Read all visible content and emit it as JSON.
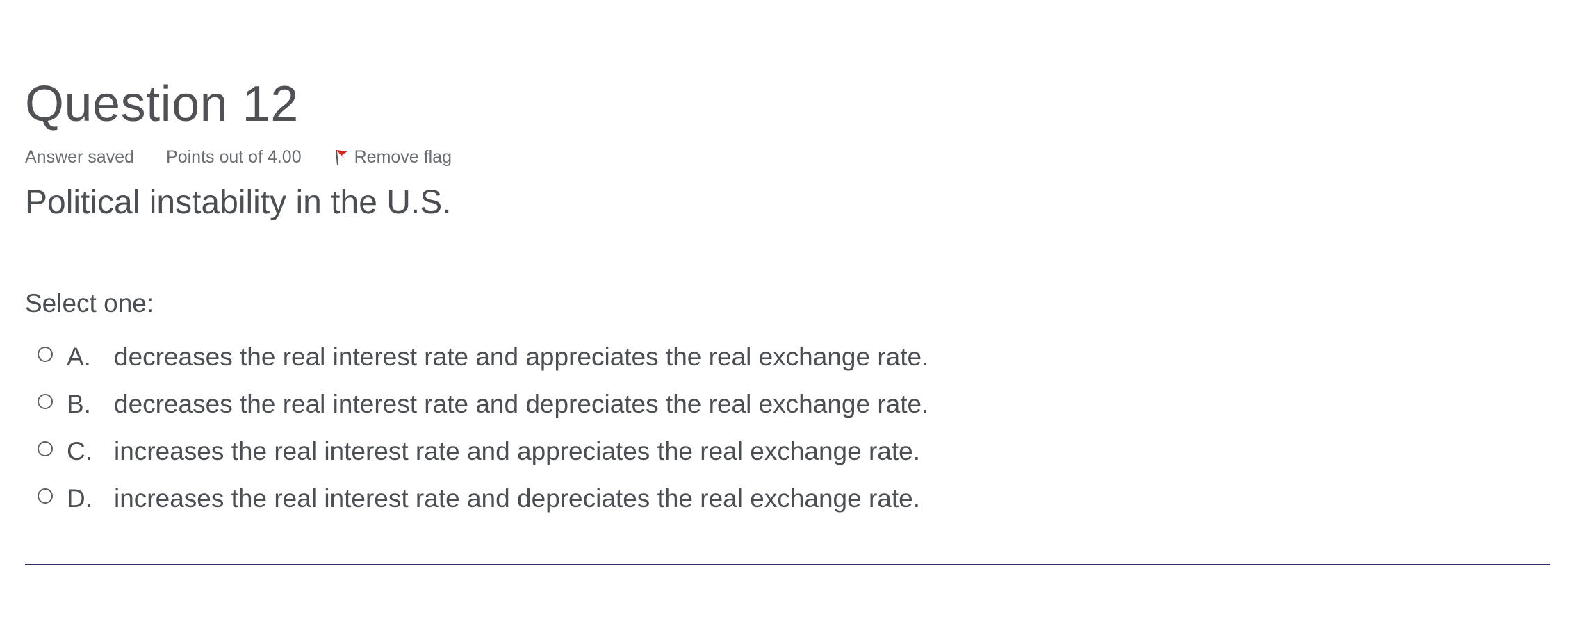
{
  "question": {
    "title": "Question 12",
    "status": "Answer saved",
    "points": "Points out of 4.00",
    "flag_label": "Remove flag",
    "flag_icon": "flag-icon",
    "flag_color": "#d62828",
    "text": "Political instability in the U.S.",
    "prompt": "Select one:",
    "answers": [
      {
        "letter": "A.",
        "text": "decreases the real interest rate and appreciates the real exchange rate."
      },
      {
        "letter": "B.",
        "text": "decreases the real interest rate and depreciates the real exchange rate."
      },
      {
        "letter": "C.",
        "text": "increases the real interest rate and appreciates the real exchange rate."
      },
      {
        "letter": "D.",
        "text": "increases the real interest rate and depreciates the real exchange rate."
      }
    ]
  },
  "divider_color": "#2e2a6b"
}
